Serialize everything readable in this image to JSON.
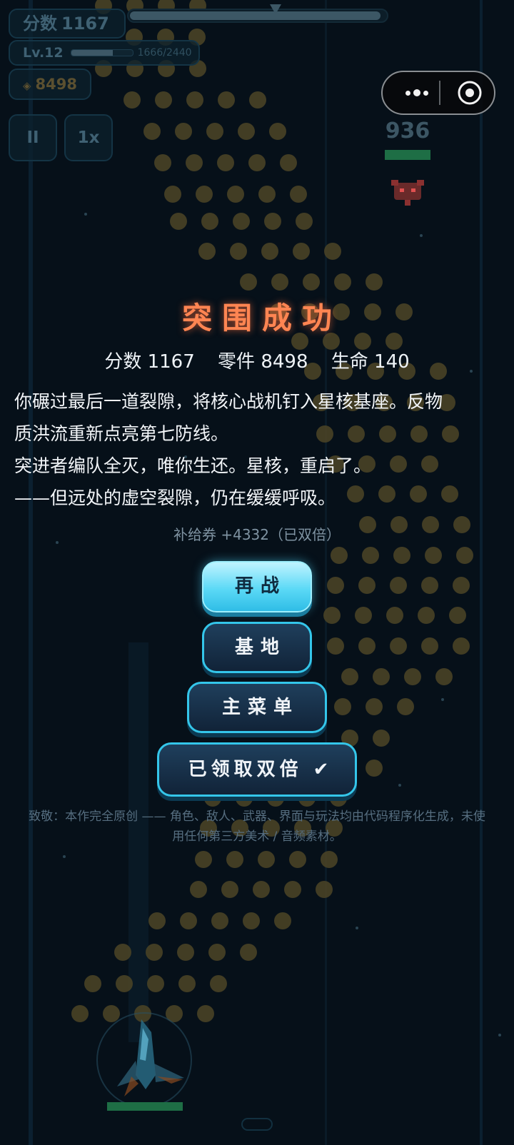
{
  "hud": {
    "score_label": "分数",
    "score_value": "1167",
    "level_label": "Lv.12",
    "xp_text": "1666/2440",
    "xp_fraction": 0.683,
    "coins_icon": "diamond-icon",
    "coins_value": "8498",
    "pause_label": "II",
    "speed_label": "1x",
    "stage_progress_fraction": 0.98
  },
  "capsule": {
    "more_icon": "more-dots-icon",
    "close_icon": "target-close-icon"
  },
  "enemy": {
    "hp_value": "936",
    "icon": "enemy-ship-icon"
  },
  "result": {
    "title": "突围成功",
    "stats": [
      {
        "label": "分数",
        "value": "1167"
      },
      {
        "label": "零件",
        "value": "8498"
      },
      {
        "label": "生命",
        "value": "140"
      }
    ],
    "story_lines": [
      "你碾过最后一道裂隙，将核心战机钉入星核基座。反物",
      "质洪流重新点亮第七防线。",
      "突进者编队全灭，唯你生还。星核，重启了。",
      "——但远处的虚空裂隙，仍在缓缓呼吸。"
    ],
    "reward_text": "补给券 +4332（已双倍）"
  },
  "buttons": {
    "retry": "再战",
    "base": "基地",
    "main_menu": "主菜单",
    "double_claimed": "已领取双倍 ✔"
  },
  "credit": {
    "line1": "致敬：本作完全原创 —— 角色、敌人、武器、界面与玩法均由代码程序化生成，未使",
    "line2": "用任何第三方美术 / 音频素材。"
  },
  "colors": {
    "background": "#061019",
    "title": "#ff8552",
    "accent": "#34c6ea",
    "coin_dot": "#5a5030",
    "hp_bar": "#1e6e45"
  }
}
